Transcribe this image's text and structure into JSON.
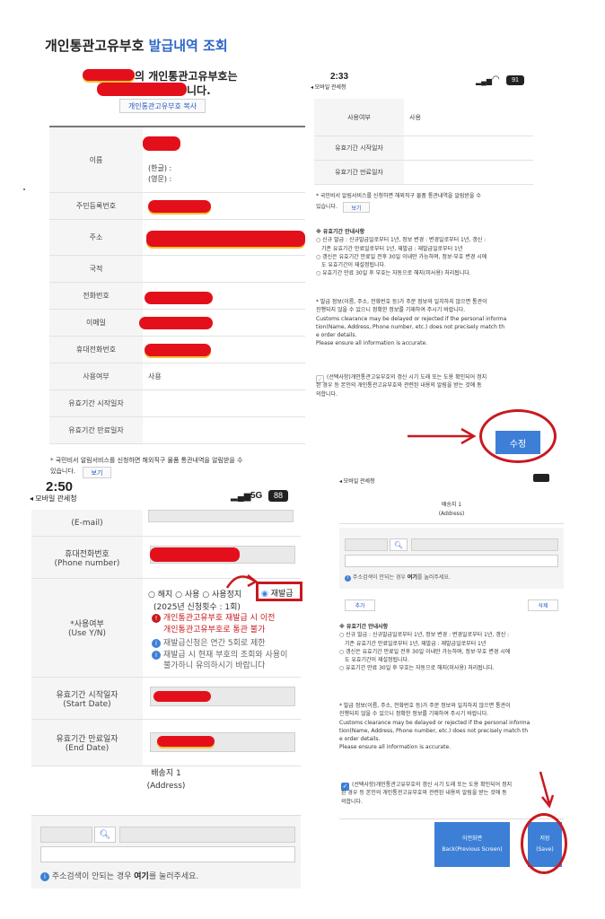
{
  "panel_a": {
    "title_main": "개인통관고유부호",
    "title_accent": "발급내역 조회",
    "subtitle_1": "의 개인통관고유부호는",
    "subtitle_2": "니다.",
    "copy_button": "개인통관고유부호 복사",
    "rows": {
      "name": "이름",
      "name_kor": "(한글) :",
      "name_eng": "(영문) :",
      "rrn": "주민등록번호",
      "address": "주소",
      "nationality": "국적",
      "phone": "전화번호",
      "email": "이메일",
      "mobile": "휴대전화번호",
      "use_yn": "사용여부",
      "use_value": "사용",
      "valid_start": "유효기간 시작일자",
      "valid_end": "유효기간 만료일자"
    },
    "notice": "* 국민비서 알림서비스를 신청하면 해외직구 물품 통관내역을 알림받을 수",
    "notice_2": "있습니다.",
    "view_button": "보기",
    "status_time": "2:50"
  },
  "panel_b": {
    "status_time": "2:33",
    "status_back": "◂ 모바일 관세청",
    "status_battery": "91",
    "use_yn": "사용여부",
    "use_value": "사용",
    "valid_start": "유효기간 시작일자",
    "valid_end": "유효기간 만료일자",
    "notice": "* 국민비서 알림서비스를 신청하면 해외직구 물품 통관내역을 알림받을 수",
    "notice_2": "있습니다.",
    "view_button": "보기",
    "guide_title": "※ 유효기간 안내사항",
    "guide_1": "○ 신규 발급 : 신규발급일로부터 1년, 정보 변경 : 변경일로부터 1년, 갱신 :",
    "guide_1b": "기존 유효기간 만료일로부터 1년, 재발급 : 재발급일로부터 1년",
    "guide_2": "○ 갱신은 유효기간 만료일 전후 30일 이내만 가능하며, 정보·부호 변경 시에",
    "guide_2b": "도 유효기간이 재설정됩니다.",
    "guide_3": "○ 유효기간 만료 30일 후 부호는 자동으로 해지(미사용) 처리됩니다.",
    "warn_1": "* 발급 정보(이름, 주소, 전화번호 등)가 주문 정보와 일치하지 않으면 통관이",
    "warn_2": "진행되지 않을 수 있으니 정확한 정보를 기재하여 주시기 바랍니다.",
    "warn_3": "Customs clearance may be delayed or rejected if the personal informa",
    "warn_4": "tion(Name, Address, Phone number, etc.) does not precisely match th",
    "warn_5": "e order details.",
    "warn_6": "Please ensure all information is accurate.",
    "consent_1": "(선택사항)개인통관고유부호의 갱신 시기 도래 또는 도용 확인되어 정지",
    "consent_2": "된 경우 등 본인의 개인통관고유부호와 관련된 내용의 알림을 받는 것에 동",
    "consent_3": "의합니다.",
    "edit_button": "수정"
  },
  "panel_c": {
    "status_time": "2:50",
    "status_back": "◂ 모바일 관세청",
    "status_network": "5G",
    "status_battery": "88",
    "email_label": "(E-mail)",
    "mobile_label": "휴대전화번호",
    "mobile_label_en": "(Phone number)",
    "radio_cancel": "해지",
    "radio_use": "사용",
    "radio_suspend": "사용정지",
    "radio_reissue": "재발급",
    "reissue_count": "(2025년 신청횟수 : 1회)",
    "use_label": "*사용여부",
    "use_label_en": "(Use Y/N)",
    "warn_red_1": "개인통관고유부호 재발급 시 이전",
    "warn_red_2": "개인통관고유부호로 통관 불가",
    "info_1": "재발급신청은 연간 5회로 제한",
    "info_2": "재발급 시 현재 부호의 조회와 사용이",
    "info_3": "불가하니 유의하시기 바랍니다",
    "start_label": "유효기간 시작일자",
    "start_label_en": "(Start Date)",
    "end_label": "유효기간 만료일자",
    "end_label_en": "(End Date)",
    "addr_label": "배송지 1",
    "addr_label_en": "(Address)",
    "addr_hint_pre": "주소검색이 안되는 경우",
    "addr_hint_link": "여기",
    "addr_hint_post": "를 눌러주세요."
  },
  "panel_d": {
    "status_back": "◂ 모바일 관세청",
    "addr_label": "배송지 1",
    "addr_label_en": "(Address)",
    "addr_hint_pre": "주소검색이 안되는 경우",
    "addr_hint_link": "여기",
    "addr_hint_post": "를 눌러주세요.",
    "add_button": "추가",
    "delete_button": "삭제",
    "guide_title": "※ 유효기간 안내사항",
    "guide_1": "○ 신규 발급 : 신규발급일로부터 1년, 정보 변경 : 변경일로부터 1년, 갱신 :",
    "guide_1b": "기존 유효기간 만료일로부터 1년, 재발급 : 재발급일로부터 1년",
    "guide_2": "○ 갱신은 유효기간 만료일 전후 30일 이내만 가능하며, 정보·부호 변경 시에",
    "guide_2b": "도 유효기간이 재설정됩니다.",
    "guide_3": "○ 유효기간 만료 30일 후 부호는 자동으로 해지(미사용) 처리됩니다.",
    "warn_1": "* 발급 정보(이름, 주소, 전화번호 등)가 주문 정보와 일치하지 않으면 통관이",
    "warn_2": "진행되지 않을 수 있으니 정확한 정보를 기재하여 주시기 바랍니다.",
    "warn_3": "Customs clearance may be delayed or rejected if the personal informa",
    "warn_4": "tion(Name, Address, Phone number, etc.) does not precisely match th",
    "warn_5": "e order details.",
    "warn_6": "Please ensure all information is accurate.",
    "consent_1": "(선택사항)개인통관고유부호의 갱신 시기 도래 또는 도용 확인되어 정지",
    "consent_2": "된 경우 등 본인의 개인통관고유부호와 관련된 내용의 알림을 받는 것에 동",
    "consent_3": "의합니다.",
    "back_button": "이전화면",
    "back_button_en": "Back(Previous Screen)",
    "save_button": "저장",
    "save_button_en": "(Save)"
  },
  "colors": {
    "primary_blue": "#3d7fd6",
    "red_mark": "#c8191f",
    "redaction": "#e3101b"
  }
}
